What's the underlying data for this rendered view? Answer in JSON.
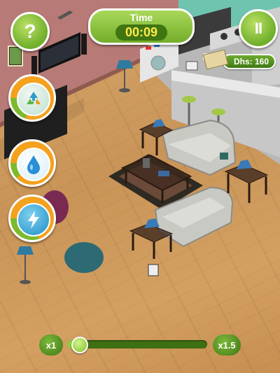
{
  "hud": {
    "help_label": "?",
    "timer_label": "Time",
    "timer_value": "00:09",
    "pause_label": "II",
    "money": "Dhs: 160"
  },
  "needs": [
    {
      "name": "recycle",
      "icon": "recycle-icon",
      "level": 0.8
    },
    {
      "name": "water",
      "icon": "water-drop-icon",
      "level": 0.88
    },
    {
      "name": "energy",
      "icon": "lightning-icon",
      "level": 0.7
    }
  ],
  "speed": {
    "min_label": "x1",
    "max_label": "x1.5",
    "level": 0.03
  },
  "colors": {
    "accent_green": "#7cba2e",
    "meter_orange": "#f4a11d",
    "floor_wood": "#cf9a5d",
    "money_text": "#ffffff",
    "timer_text": "#ffe94a"
  }
}
